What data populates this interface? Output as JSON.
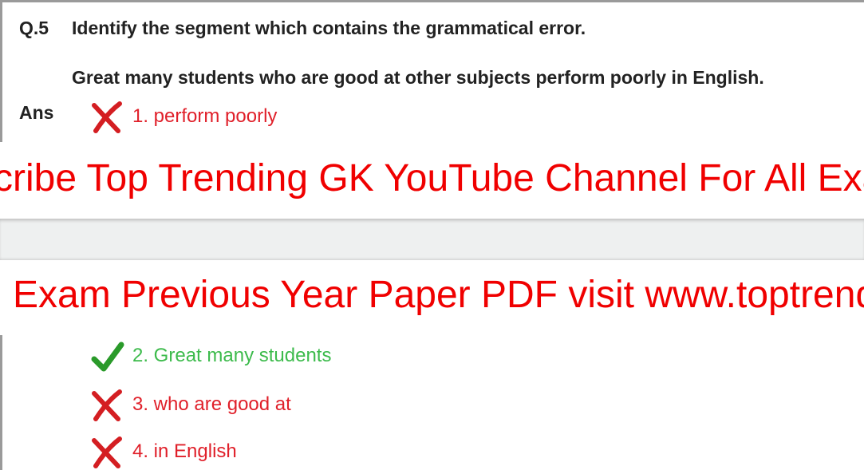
{
  "question": {
    "number": "Q.5",
    "prompt": "Identify the segment which contains the grammatical error.",
    "sentence": "Great many students who are good at other subjects perform poorly in English.",
    "ans_label": "Ans"
  },
  "options": [
    {
      "label": "1. perform poorly",
      "status": "wrong",
      "icon": "cross-icon"
    },
    {
      "label": "2. Great many students",
      "status": "correct",
      "icon": "check-icon"
    },
    {
      "label": "3. who are good at",
      "status": "wrong",
      "icon": "cross-icon"
    },
    {
      "label": "4. in English",
      "status": "wrong",
      "icon": "cross-icon"
    }
  ],
  "banners": {
    "top": "cribe Top Trending GK YouTube Channel For All Exa",
    "bottom": "l Exam Previous Year Paper PDF visit www.toptrend"
  },
  "colors": {
    "wrong": "#e0202a",
    "correct": "#3dbb4c",
    "banner": "#f00000"
  }
}
